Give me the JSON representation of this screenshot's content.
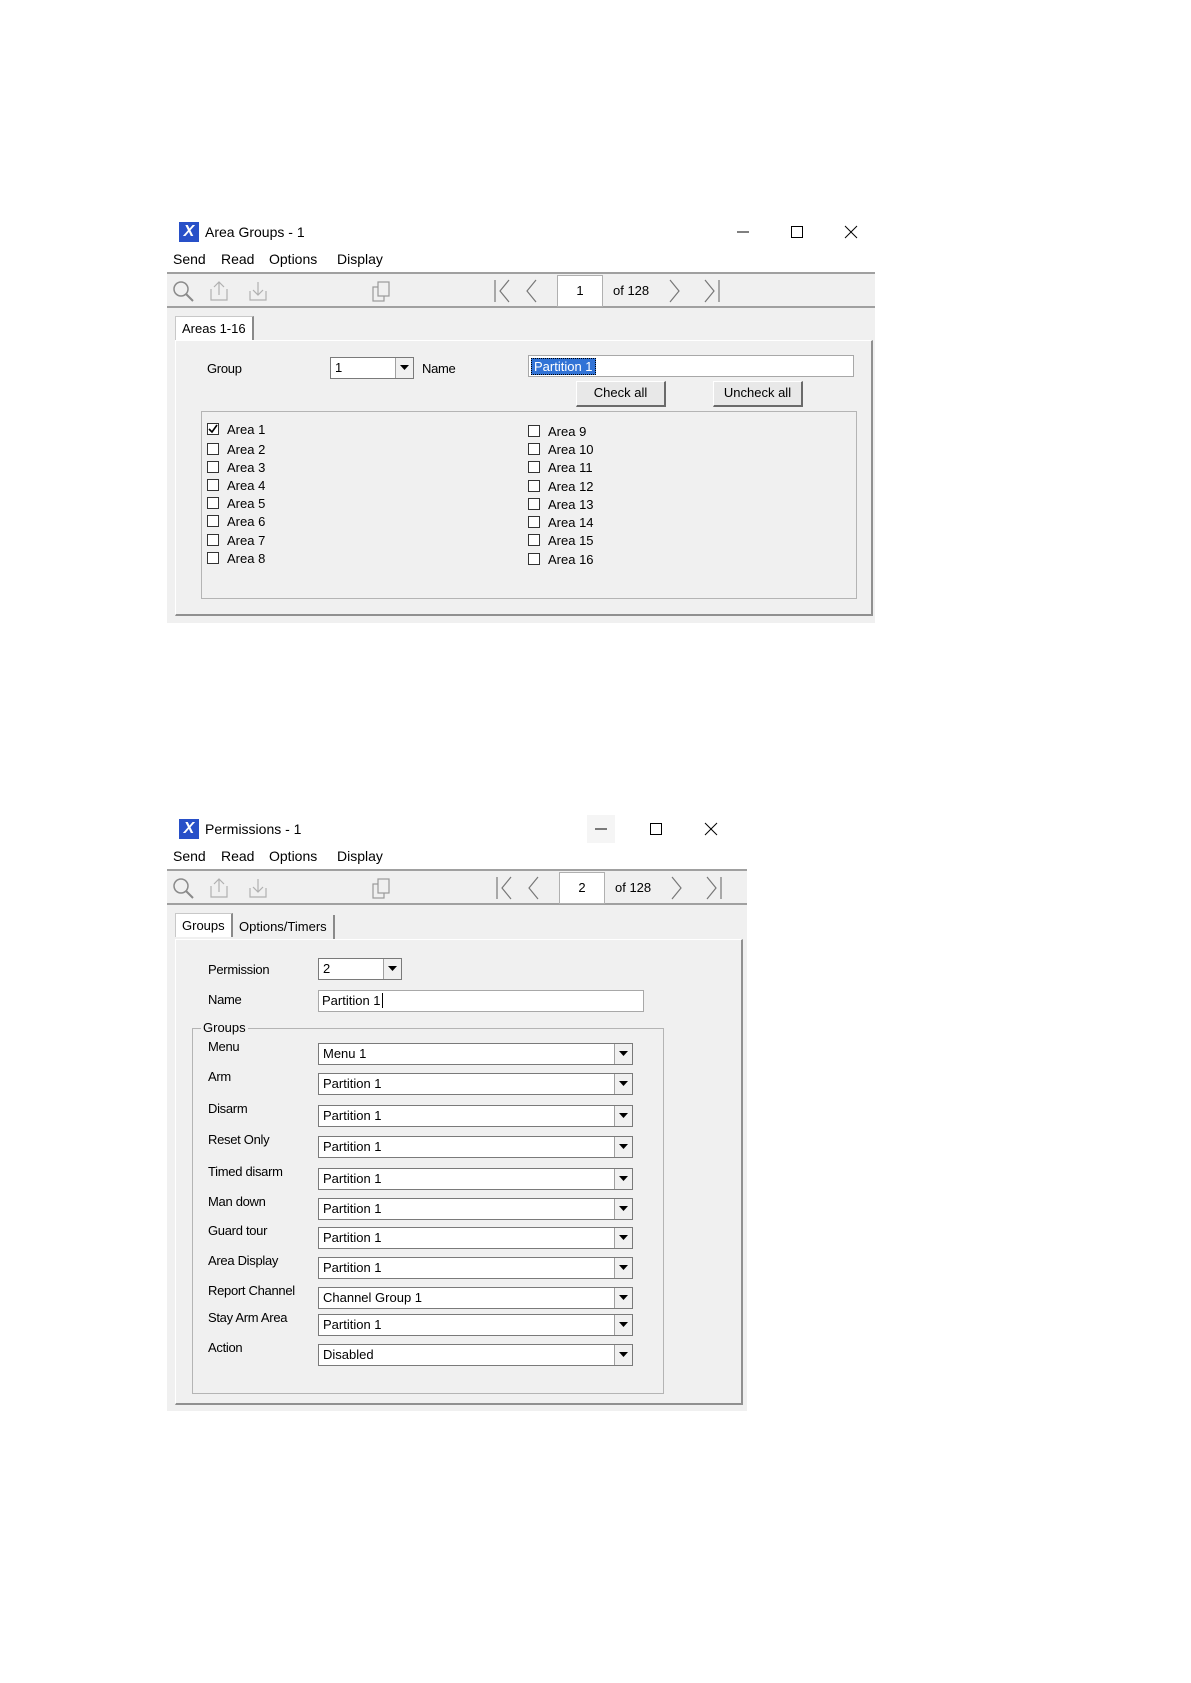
{
  "window1": {
    "title": "Area Groups - 1",
    "menu": [
      "Send",
      "Read",
      "Options",
      "Display"
    ],
    "pager": {
      "current": "1",
      "of": "of 128"
    },
    "tab": "Areas 1-16",
    "group_label": "Group",
    "group_value": "1",
    "name_label": "Name",
    "name_value": "Partition 1",
    "check_all": "Check all",
    "uncheck_all": "Uncheck all",
    "areas_left": [
      {
        "label": "Area 1",
        "checked": true
      },
      {
        "label": "Area 2",
        "checked": false
      },
      {
        "label": "Area 3",
        "checked": false
      },
      {
        "label": "Area 4",
        "checked": false
      },
      {
        "label": "Area 5",
        "checked": false
      },
      {
        "label": "Area 6",
        "checked": false
      },
      {
        "label": "Area 7",
        "checked": false
      },
      {
        "label": "Area 8",
        "checked": false
      }
    ],
    "areas_right": [
      {
        "label": "Area 9",
        "checked": false
      },
      {
        "label": "Area 10",
        "checked": false
      },
      {
        "label": "Area 11",
        "checked": false
      },
      {
        "label": "Area 12",
        "checked": false
      },
      {
        "label": "Area 13",
        "checked": false
      },
      {
        "label": "Area 14",
        "checked": false
      },
      {
        "label": "Area 15",
        "checked": false
      },
      {
        "label": "Area 16",
        "checked": false
      }
    ]
  },
  "window2": {
    "title": "Permissions - 1",
    "menu": [
      "Send",
      "Read",
      "Options",
      "Display"
    ],
    "pager": {
      "current": "2",
      "of": "of 128"
    },
    "tabs": [
      "Groups",
      "Options/Timers"
    ],
    "permission_label": "Permission",
    "permission_value": "2",
    "name_label": "Name",
    "name_value": "Partition 1",
    "groups_title": "Groups",
    "fields": [
      {
        "label": "Menu",
        "value": "Menu 1"
      },
      {
        "label": "Arm",
        "value": "Partition 1"
      },
      {
        "label": "Disarm",
        "value": "Partition 1"
      },
      {
        "label": "Reset Only",
        "value": "Partition 1"
      },
      {
        "label": "Timed disarm",
        "value": "Partition 1"
      },
      {
        "label": "Man down",
        "value": "Partition 1"
      },
      {
        "label": "Guard tour",
        "value": "Partition 1"
      },
      {
        "label": "Area Display",
        "value": "Partition 1"
      },
      {
        "label": "Report Channel",
        "value": "Channel Group 1"
      },
      {
        "label": "Stay Arm Area",
        "value": "Partition 1"
      },
      {
        "label": "Action",
        "value": "Disabled"
      }
    ]
  },
  "icons": {
    "app": "x-app-icon",
    "toolbar": [
      "search-icon",
      "upload-icon",
      "download-icon",
      "copy-icon",
      "first-page-icon",
      "prev-page-icon",
      "next-page-icon",
      "last-page-icon"
    ]
  },
  "colors": {
    "app_icon": "#2850c8",
    "selection": "#3173d6",
    "window_bg": "#f0f0f0"
  }
}
